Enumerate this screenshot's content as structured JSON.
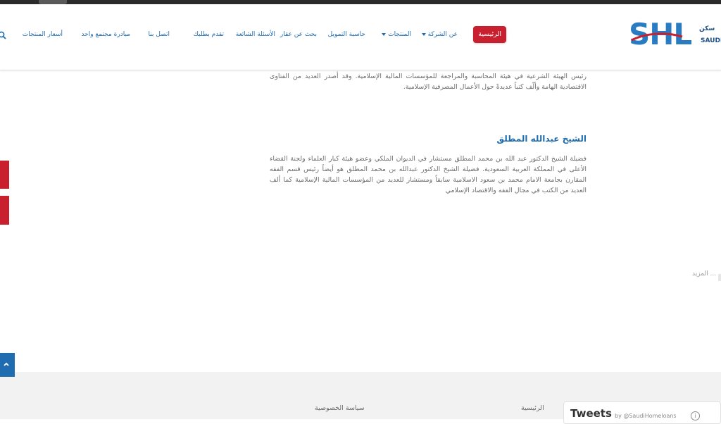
{
  "header": {
    "logo": {
      "text": "SHL",
      "ar": "سكن",
      "en": "SAUDI"
    },
    "nav": [
      {
        "label": "الرئيسية",
        "active": true
      },
      {
        "label": "عن الشركة",
        "dropdown": true
      },
      {
        "label": "المنتجات",
        "dropdown": true
      },
      {
        "label": "حاسبة التمويل"
      },
      {
        "label": "بحث عن عقار"
      },
      {
        "label": "الأسئلة الشائعة"
      },
      {
        "label": "تقدم بطلبك"
      },
      {
        "label": "اتصل بنا"
      },
      {
        "label": "مبادرة مجتمع واحد"
      },
      {
        "label": "أسعار المنتجات"
      }
    ]
  },
  "content": {
    "para1": "رئيس الهيئة الشرعية في هيئة المحاسبة والمراجعة للمؤسسات المالية الإسلامية. وقد أصدر العديد من الفتاوى الاقتصادية الهامة وألّف كتباً عديدةً حول الأعمال المصرفية الإسلامية.",
    "heading": "الشيخ عبدالله المطلق",
    "para2": "فضيلة الشيخ الدكتور عبد الله بن محمد المطلق مستشار في الديوان الملكي وعضو هيئة كبار العلماء ولجنة القضاء الأعلى في المملكة العربية السعودية. فضيلة الشيخ الدكتور عبدالله بن محمد المطلق هو أيضاً رئيس قسم الفقه المقارن بجامعة الامام محمد بن سعود الاسلامية سابقاً ومستشار للعديد من المؤسسات المالية الإسلامية كما ألف العديد من الكتب في مجال الفقه والاقتصاد الإسلامي",
    "more": "... المزيد"
  },
  "footer": {
    "links": [
      "الرئيسية",
      "سياسة الخصوصية"
    ],
    "tweets_title": "Tweets",
    "tweets_by": "by @SaudiHomeloans"
  },
  "colors": {
    "brand_blue": "#1f6db0",
    "brand_red": "#c8202f",
    "footer_bg": "#f3f2f2"
  }
}
